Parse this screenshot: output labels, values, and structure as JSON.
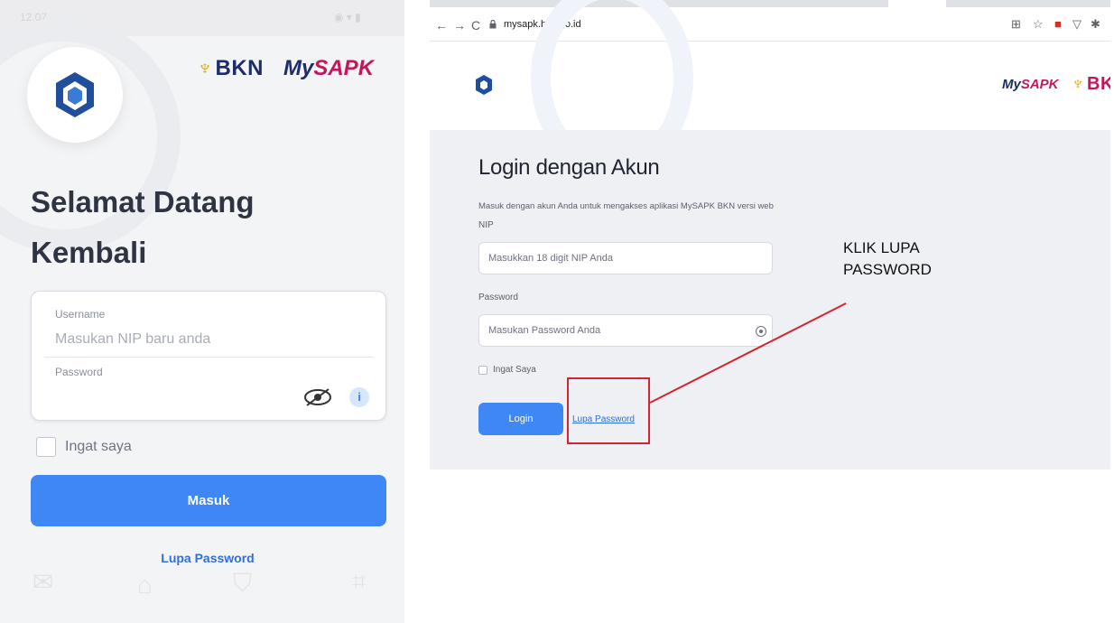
{
  "mobile": {
    "status_time": "12.07",
    "brand_bkn": "BKN",
    "brand_my": "My",
    "brand_sapk": "SAPK",
    "welcome_line1": "Selamat Datang",
    "welcome_line2": "Kembali",
    "username_label": "Username",
    "username_placeholder": "Masukan NIP baru anda",
    "password_label": "Password",
    "info_glyph": "i",
    "remember_label": "Ingat saya",
    "login_button": "Masuk",
    "forgot_link": "Lupa Password"
  },
  "browser": {
    "url": "mysapk.bkn.go.id",
    "nav_back": "←",
    "nav_forward": "→",
    "nav_reload": "C",
    "brand_my": "My",
    "brand_sapk": "SAPK",
    "brand_bkn": "BKN",
    "title": "Login dengan Akun",
    "description": "Masuk dengan akun Anda untuk mengakses aplikasi MySAPK BKN versi web",
    "nip_label": "NIP",
    "nip_placeholder": "Masukkan 18 digit NIP Anda",
    "password_label": "Password",
    "password_placeholder": "Masukan Password Anda",
    "remember_label": "Ingat Saya",
    "login_button": "Login",
    "forgot_link": "Lupa Password"
  },
  "annotation": {
    "text": "KLIK LUPA PASSWORD"
  },
  "colors": {
    "accent_blue": "#3f87f5",
    "link_blue": "#2f6fda",
    "highlight_red": "#d6232f",
    "brand_navy": "#1d2d6b",
    "brand_magenta": "#c2185b",
    "brand_gold": "#e2a400"
  },
  "icons": [
    "app-logo-icon",
    "garuda-icon",
    "eye-off-icon",
    "info-icon",
    "eye-icon",
    "lock-icon",
    "back-icon",
    "forward-icon",
    "reload-icon",
    "translate-icon",
    "star-icon",
    "pdf-icon",
    "shield-icon",
    "puzzle-icon"
  ]
}
